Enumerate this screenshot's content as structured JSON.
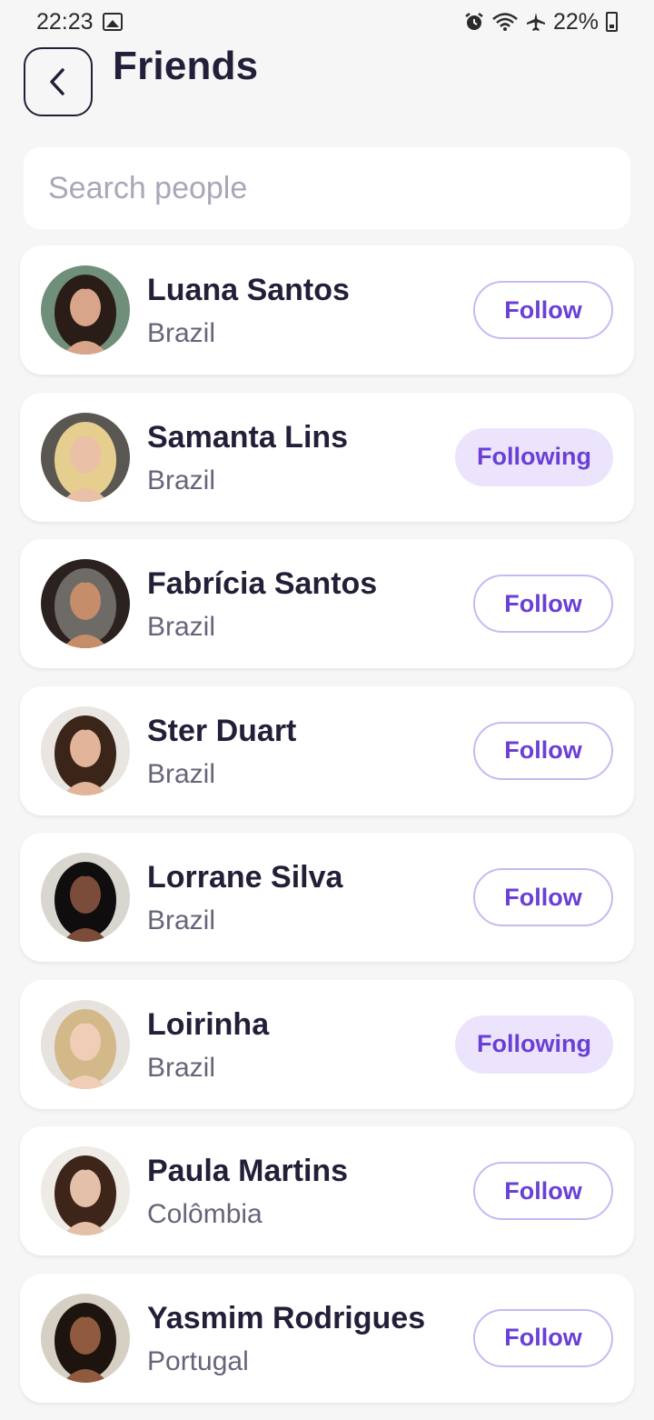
{
  "status": {
    "time": "22:23",
    "battery": "22%"
  },
  "header": {
    "title": "Friends"
  },
  "search": {
    "placeholder": "Search people"
  },
  "people": [
    {
      "name": "Luana Santos",
      "country": "Brazil",
      "action": "Follow",
      "following": false,
      "hair": "#2a1c16",
      "skin": "#d8a48a",
      "bg": "#6f8f7a"
    },
    {
      "name": "Samanta Lins",
      "country": "Brazil",
      "action": "Following",
      "following": true,
      "hair": "#e6cf8e",
      "skin": "#eac0a6",
      "bg": "#5a5752"
    },
    {
      "name": "Fabrícia Santos",
      "country": "Brazil",
      "action": "Follow",
      "following": false,
      "hair": "#6e6a66",
      "skin": "#c58d6a",
      "bg": "#2b2220"
    },
    {
      "name": "Ster Duart",
      "country": "Brazil",
      "action": "Follow",
      "following": false,
      "hair": "#3b2418",
      "skin": "#e2b49a",
      "bg": "#e9e5e1"
    },
    {
      "name": "Lorrane Silva",
      "country": "Brazil",
      "action": "Follow",
      "following": false,
      "hair": "#0f0d0d",
      "skin": "#7a4c39",
      "bg": "#d9d5cf"
    },
    {
      "name": "Loirinha",
      "country": "Brazil",
      "action": "Following",
      "following": true,
      "hair": "#d3b889",
      "skin": "#f0cdb6",
      "bg": "#e6e2dd"
    },
    {
      "name": "Paula Martins",
      "country": "Colômbia",
      "action": "Follow",
      "following": false,
      "hair": "#3e2519",
      "skin": "#e5c0a8",
      "bg": "#eeeae6"
    },
    {
      "name": "Yasmim Rodrigues",
      "country": "Portugal",
      "action": "Follow",
      "following": false,
      "hair": "#1e140f",
      "skin": "#8f5a3e",
      "bg": "#d6cfc4"
    }
  ]
}
